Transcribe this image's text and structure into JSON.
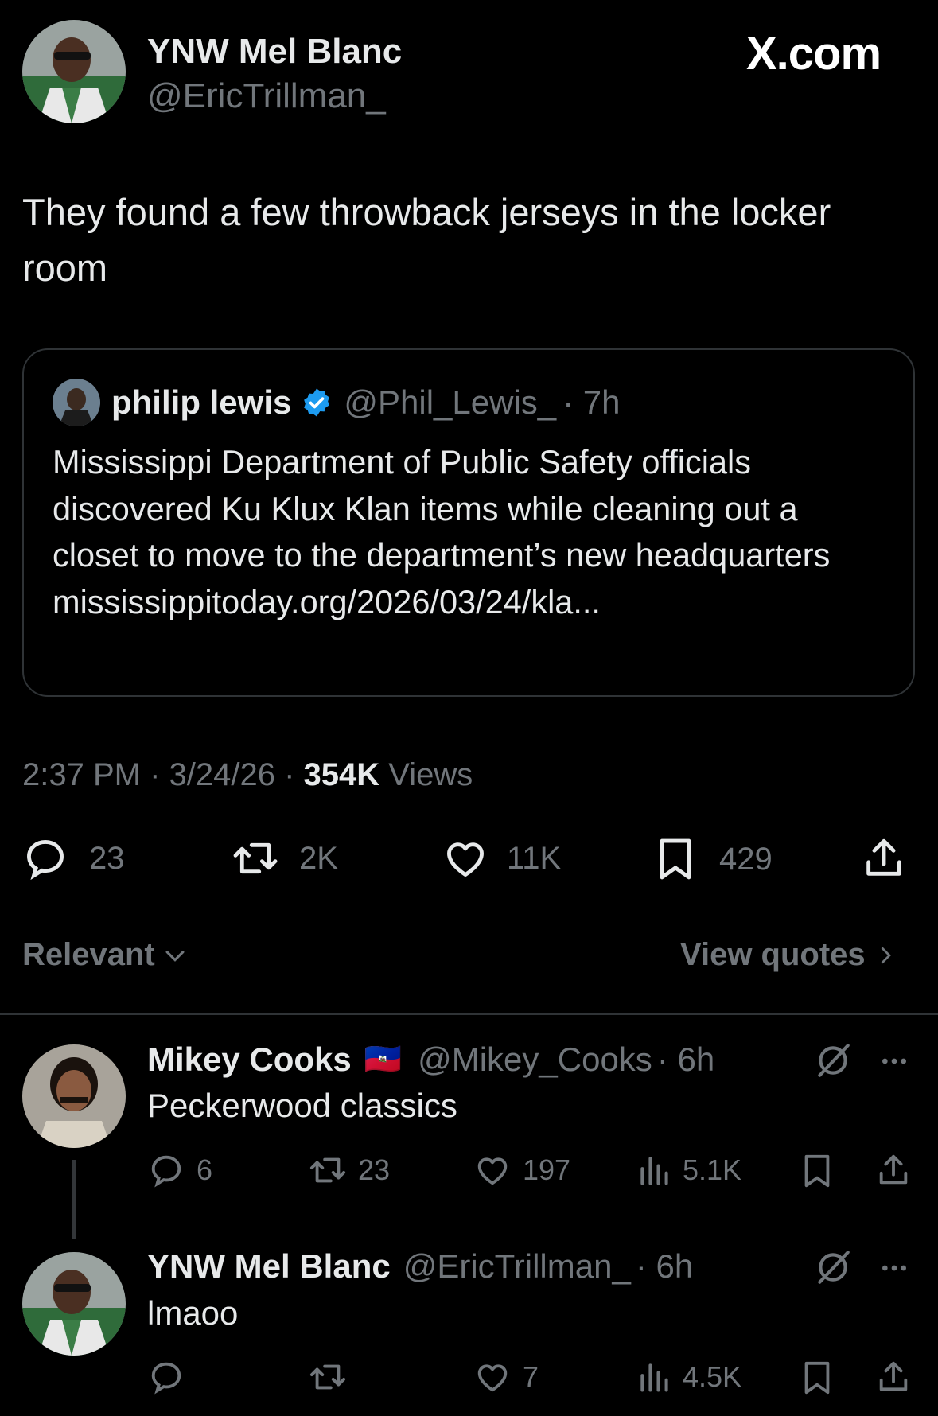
{
  "header": {
    "author_name": "YNW Mel Blanc",
    "author_handle": "@EricTrillman_",
    "watermark": "X.com"
  },
  "tweet": {
    "text": "They found a few throwback jerseys in the locker room",
    "quote": {
      "name": "philip lewis",
      "handle": "@Phil_Lewis_",
      "time": "· 7h",
      "text": "Mississippi Department of Public Safety officials discovered Ku Klux Klan items while cleaning out a closet to move to the department’s new headquarters mississippitoday.org/2026/03/24/kla..."
    },
    "meta": {
      "time": "2:37 PM · 3/24/26 · ",
      "views_count": "354K",
      "views_label": " Views"
    },
    "actions": {
      "replies": "23",
      "retweets": "2K",
      "likes": "11K",
      "bookmarks": "429"
    }
  },
  "filters": {
    "sort_label": "Relevant",
    "view_quotes_label": "View quotes"
  },
  "replies": [
    {
      "name": "Mikey Cooks",
      "flag": "🇭🇹",
      "handle": "@Mikey_Cooks",
      "time": "· 6h",
      "text": "Peckerwood classics",
      "replies": "6",
      "retweets": "23",
      "likes": "197",
      "views": "5.1K"
    },
    {
      "name": "YNW Mel Blanc",
      "handle": "@EricTrillman_",
      "time": "· 6h",
      "text": "lmaoo",
      "replies": "",
      "retweets": "",
      "likes": "7",
      "views": "4.5K"
    }
  ],
  "colors": {
    "background": "#000000",
    "text": "#e7e9ea",
    "muted": "#71767b",
    "verified": "#1d9bf0",
    "border": "#2f3336"
  }
}
